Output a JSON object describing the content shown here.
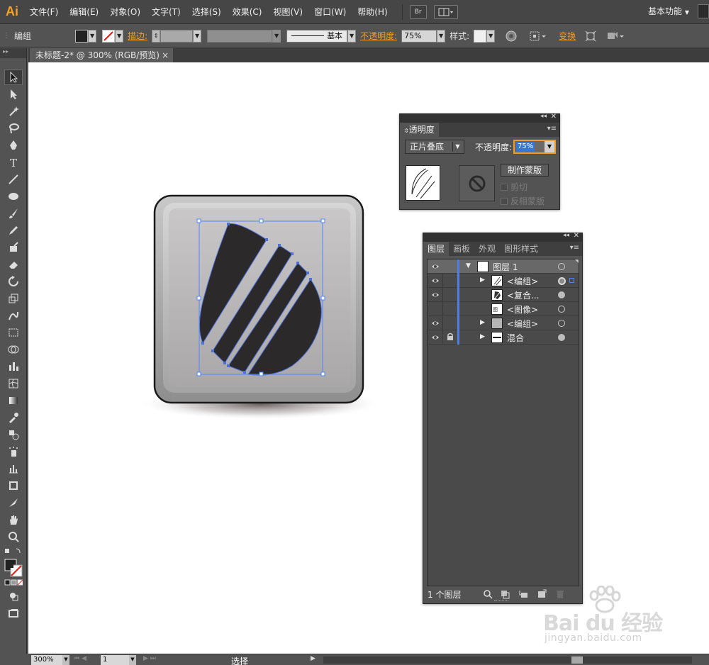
{
  "app": {
    "logo": "Ai",
    "workspace": "基本功能"
  },
  "menu": [
    "文件(F)",
    "编辑(E)",
    "对象(O)",
    "文字(T)",
    "选择(S)",
    "效果(C)",
    "视图(V)",
    "窗口(W)",
    "帮助(H)"
  ],
  "menubar_buttons": {
    "bridge": "Br"
  },
  "control": {
    "selection_type": "编组",
    "stroke_label": "描边:",
    "stroke_style": "基本",
    "opacity_label": "不透明度:",
    "opacity_value": "75%",
    "style_label": "样式:",
    "transform_label": "变换"
  },
  "document": {
    "tab_title": "未标题-2* @ 300% (RGB/预览)",
    "close": "×"
  },
  "transparency_panel": {
    "tab": "透明度",
    "blend_mode": "正片叠底",
    "opacity_label": "不透明度:",
    "opacity_value": "75%",
    "make_mask": "制作蒙版",
    "clip": "剪切",
    "invert_mask": "反相蒙版"
  },
  "layers_panel": {
    "tabs": [
      "图层",
      "画板",
      "外观",
      "图形样式"
    ],
    "rows": [
      {
        "name": "图层 1"
      },
      {
        "name": "<编组>"
      },
      {
        "name": "<复合..."
      },
      {
        "name": "<图像>"
      },
      {
        "name": "<编组>"
      },
      {
        "name": "混合"
      }
    ],
    "count": "1 个图层"
  },
  "status": {
    "zoom": "300%",
    "page": "1",
    "tool": "选择"
  },
  "watermark": {
    "brand": "Bai du 经验",
    "url": "jingyan.baidu.com"
  },
  "colors": {
    "accent_orange": "#f39c28",
    "selection_blue": "#4d86ff",
    "panel_bg": "#535353"
  }
}
